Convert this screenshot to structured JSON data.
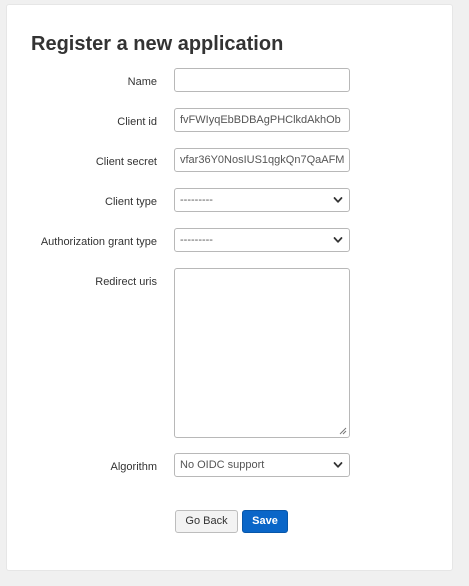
{
  "page": {
    "title": "Register a new application"
  },
  "form": {
    "name": {
      "label": "Name",
      "value": ""
    },
    "client_id": {
      "label": "Client id",
      "value": "fvFWIyqEbBDBAgPHClkdAkhOb"
    },
    "client_secret": {
      "label": "Client secret",
      "value": "vfar36Y0NosIUS1qgkQn7QaAFM"
    },
    "client_type": {
      "label": "Client type",
      "selected": "---------",
      "icon": "chevron-down-icon"
    },
    "authorization_grant_type": {
      "label": "Authorization grant type",
      "selected": "---------",
      "icon": "chevron-down-icon"
    },
    "redirect_uris": {
      "label": "Redirect uris",
      "value": ""
    },
    "algorithm": {
      "label": "Algorithm",
      "selected": "No OIDC support",
      "icon": "chevron-down-icon"
    }
  },
  "actions": {
    "back_label": "Go Back",
    "save_label": "Save"
  },
  "colors": {
    "page_background": "#f0f0f0",
    "card_background": "#ffffff",
    "primary_button": "#0a66c8",
    "text": "#333333",
    "input_border": "#b8b8b8"
  }
}
